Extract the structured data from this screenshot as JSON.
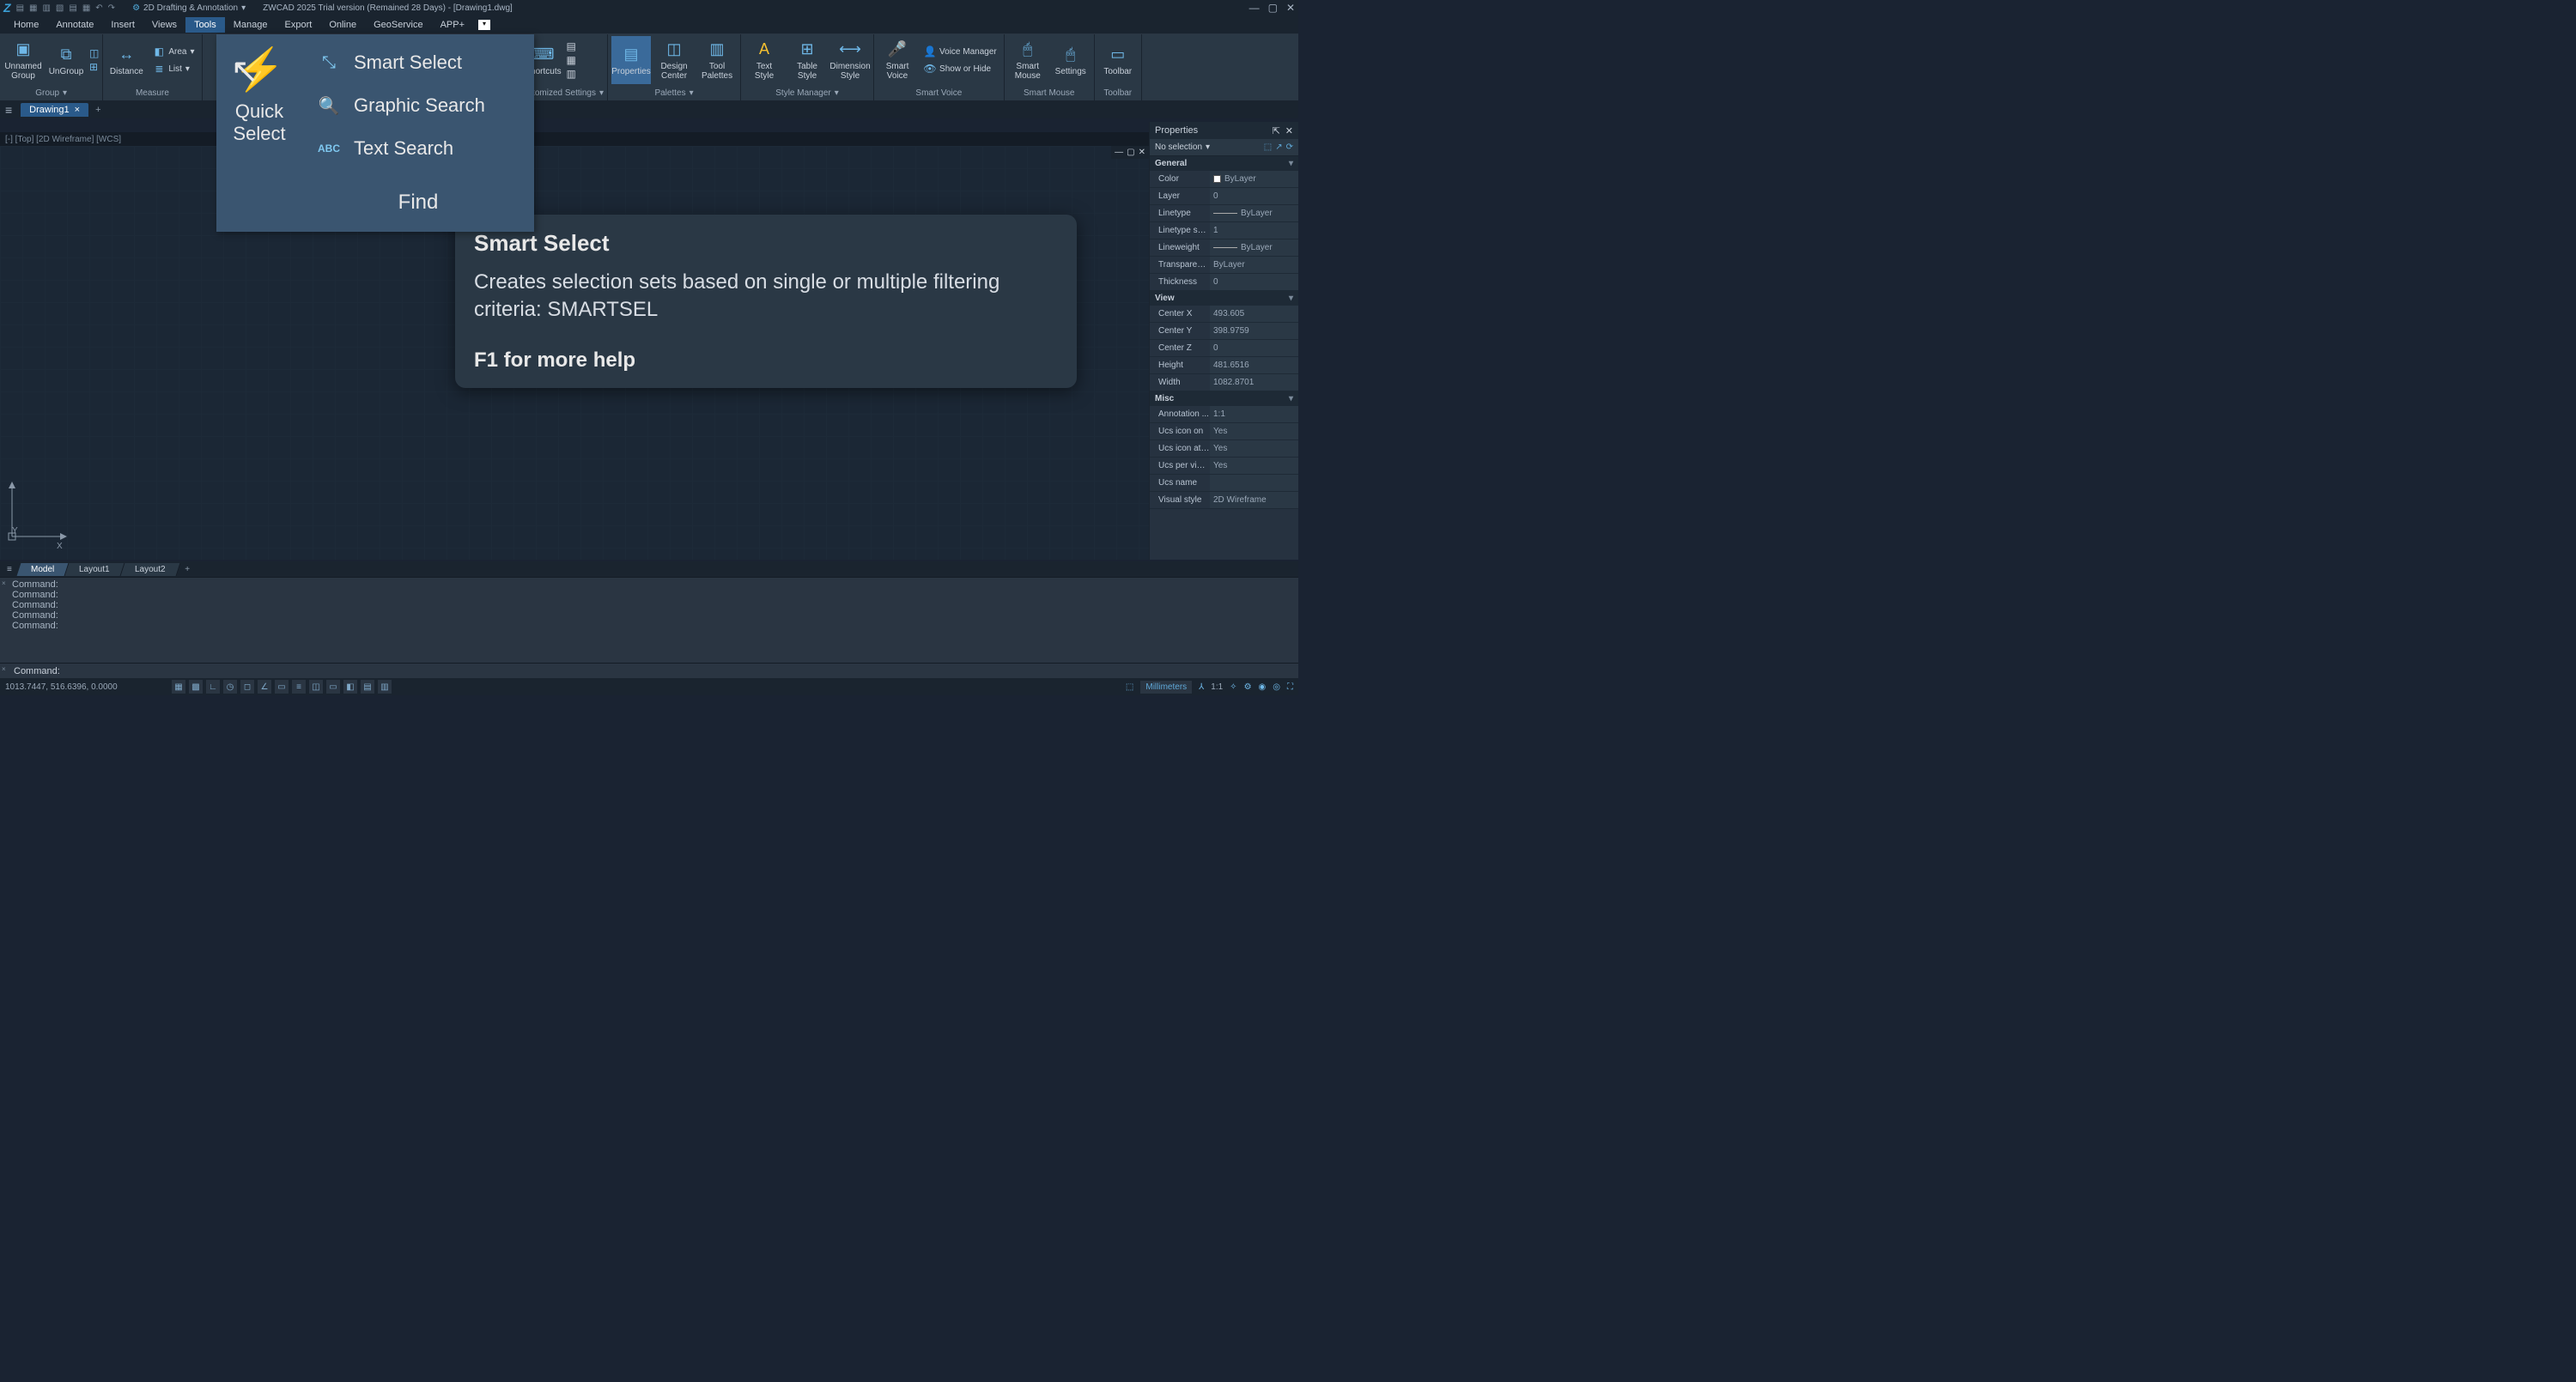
{
  "titlebar": {
    "workspace": "2D Drafting & Annotation",
    "title": "ZWCAD 2025 Trial version (Remained 28 Days) - [Drawing1.dwg]"
  },
  "menu": {
    "items": [
      "Home",
      "Annotate",
      "Insert",
      "Views",
      "Tools",
      "Manage",
      "Export",
      "Online",
      "GeoService",
      "APP+"
    ],
    "active": "Tools"
  },
  "ribbon": {
    "group_group": {
      "label": "Group",
      "unnamed": "Unnamed\nGroup",
      "ungroup": "UnGroup"
    },
    "group_measure": {
      "label": "Measure",
      "distance": "Distance",
      "area": "Area",
      "list": "List"
    },
    "group_custom": {
      "label": "ustomized Settings",
      "shortcuts": "Shortcuts"
    },
    "group_palettes": {
      "label": "Palettes",
      "properties": "Properties",
      "design": "Design\nCenter",
      "tool": "Tool\nPalettes"
    },
    "group_style": {
      "label": "Style Manager",
      "text": "Text\nStyle",
      "table": "Table\nStyle",
      "dim": "Dimension\nStyle"
    },
    "group_voice": {
      "label": "Smart Voice",
      "smart": "Smart\nVoice",
      "voicemgr": "Voice Manager",
      "showhide": "Show or Hide"
    },
    "group_mouse": {
      "label": "Smart Mouse",
      "smartmouse": "Smart\nMouse",
      "settings": "Settings"
    },
    "group_toolbar": {
      "label": "Toolbar",
      "toolbar": "Toolbar"
    }
  },
  "find_panel": {
    "heading": "Quick\nSelect",
    "items": [
      "Smart Select",
      "Graphic Search",
      "Text Search"
    ],
    "footer": "Find"
  },
  "tooltip": {
    "title": "Smart Select",
    "body": "Creates selection sets based on single or multiple filtering criteria: SMARTSEL",
    "help": "F1 for more help"
  },
  "tabs": {
    "drawing": "Drawing1"
  },
  "vpinfo": "[-] [Top] [2D Wireframe] [WCS]",
  "layouts": {
    "model": "Model",
    "l1": "Layout1",
    "l2": "Layout2"
  },
  "cmd": {
    "lines": [
      "Command:",
      "Command:",
      "Command:",
      "Command:",
      "Command:"
    ],
    "prompt": "Command:"
  },
  "status": {
    "coords": "1013.7447, 516.6396, 0.0000",
    "units": "Millimeters",
    "scale": "1:1"
  },
  "props": {
    "title": "Properties",
    "nosel": "No selection",
    "sections": {
      "general": {
        "label": "General",
        "rows": [
          {
            "k": "Color",
            "v": "ByLayer",
            "swatch": true
          },
          {
            "k": "Layer",
            "v": "0"
          },
          {
            "k": "Linetype",
            "v": "ByLayer",
            "line": true
          },
          {
            "k": "Linetype scale",
            "v": "1"
          },
          {
            "k": "Lineweight",
            "v": "ByLayer",
            "line": true
          },
          {
            "k": "Transparency",
            "v": "ByLayer"
          },
          {
            "k": "Thickness",
            "v": "0"
          }
        ]
      },
      "view": {
        "label": "View",
        "rows": [
          {
            "k": "Center X",
            "v": "493.605"
          },
          {
            "k": "Center Y",
            "v": "398.9759"
          },
          {
            "k": "Center Z",
            "v": "0"
          },
          {
            "k": "Height",
            "v": "481.6516"
          },
          {
            "k": "Width",
            "v": "1082.8701"
          }
        ]
      },
      "misc": {
        "label": "Misc",
        "rows": [
          {
            "k": "Annotation ...",
            "v": "1:1"
          },
          {
            "k": "Ucs icon on",
            "v": "Yes"
          },
          {
            "k": "Ucs icon at ...",
            "v": "Yes"
          },
          {
            "k": "Ucs per view...",
            "v": "Yes"
          },
          {
            "k": "Ucs name",
            "v": ""
          },
          {
            "k": "Visual style",
            "v": "2D Wireframe"
          }
        ]
      }
    }
  }
}
